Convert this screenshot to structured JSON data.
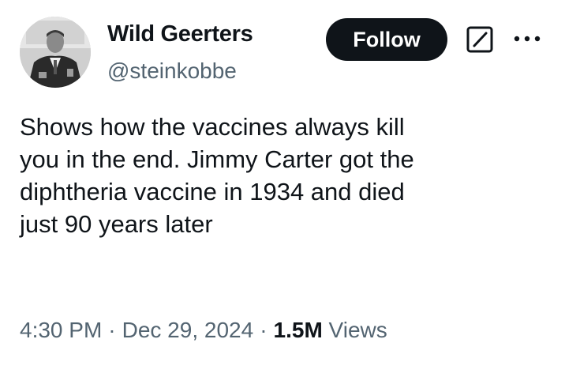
{
  "author": {
    "display_name": "Wild Geerters",
    "handle": "@steinkobbe"
  },
  "actions": {
    "follow_label": "Follow"
  },
  "icons": {
    "grok": "grok-icon",
    "more": "more-options-icon"
  },
  "tweet": {
    "text": "Shows how the vaccines always kill\nyou in the end. Jimmy Carter got the\ndiphtheria vaccine in 1934 and died\njust 90 years later"
  },
  "meta": {
    "time": "4:30 PM",
    "separator": "·",
    "date": "Dec 29, 2024",
    "views_count": "1.5M",
    "views_label": "Views"
  },
  "colors": {
    "text_primary": "#0f1419",
    "text_secondary": "#536471",
    "button_bg": "#0f1419",
    "button_text": "#ffffff"
  }
}
